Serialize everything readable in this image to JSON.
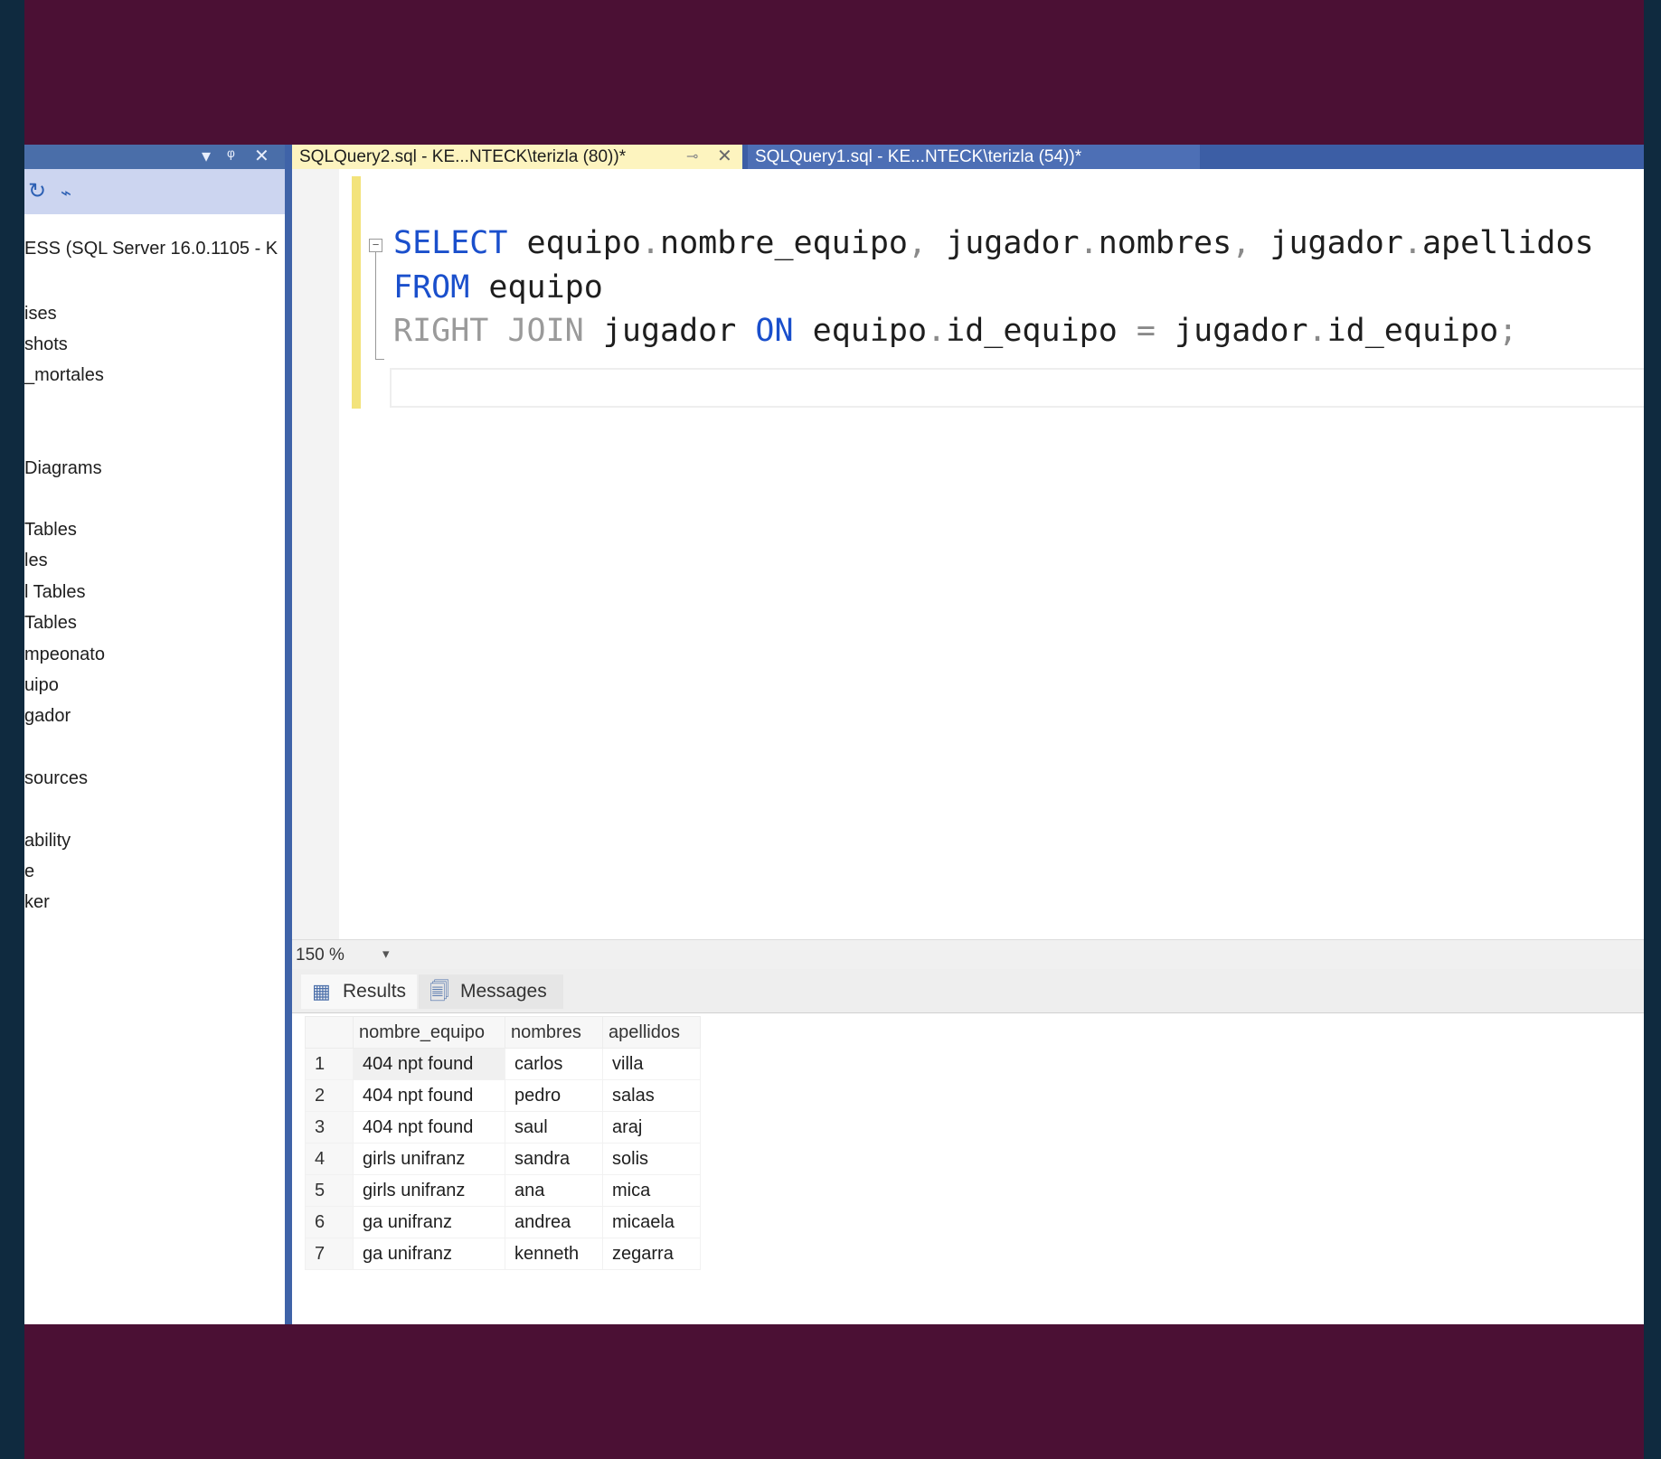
{
  "tabs": [
    {
      "label": "SQLQuery2.sql - KE...NTECK\\terizla (80))*",
      "pin": "⊸",
      "close": "✕"
    },
    {
      "label": "SQLQuery1.sql - KE...NTECK\\terizla (54))*"
    }
  ],
  "explorer": {
    "controls": [
      "▾",
      "ᵠ",
      "✕"
    ],
    "toolbar_icons": [
      "refresh-icon",
      "activity-icon"
    ],
    "server": "ESS (SQL Server 16.0.1105 - K",
    "nodes": [
      "ises",
      "shots",
      "_mortales",
      "Diagrams",
      "Tables",
      "les",
      "l Tables",
      "Tables",
      "mpeonato",
      "uipo",
      "gador",
      "sources",
      "ability",
      "e",
      "ker"
    ]
  },
  "editor": {
    "lines": [
      "SELECT equipo.nombre_equipo, jugador.nombres, jugador.apellidos",
      "FROM equipo",
      "RIGHT JOIN jugador ON equipo.id_equipo = jugador.id_equipo;"
    ]
  },
  "zoom": {
    "value": "150 %"
  },
  "results": {
    "tabs": [
      "Results",
      "Messages"
    ],
    "columns": [
      "nombre_equipo",
      "nombres",
      "apellidos"
    ],
    "rows": [
      [
        "1",
        "404 npt found",
        "carlos",
        "villa"
      ],
      [
        "2",
        "404 npt found",
        "pedro",
        "salas"
      ],
      [
        "3",
        "404 npt found",
        "saul",
        "araj"
      ],
      [
        "4",
        "girls unifranz",
        "sandra",
        "solis"
      ],
      [
        "5",
        "girls unifranz",
        "ana",
        "mica"
      ],
      [
        "6",
        "ga unifranz",
        "andrea",
        "micaela"
      ],
      [
        "7",
        "ga unifranz",
        "kenneth",
        "zegarra"
      ]
    ]
  }
}
